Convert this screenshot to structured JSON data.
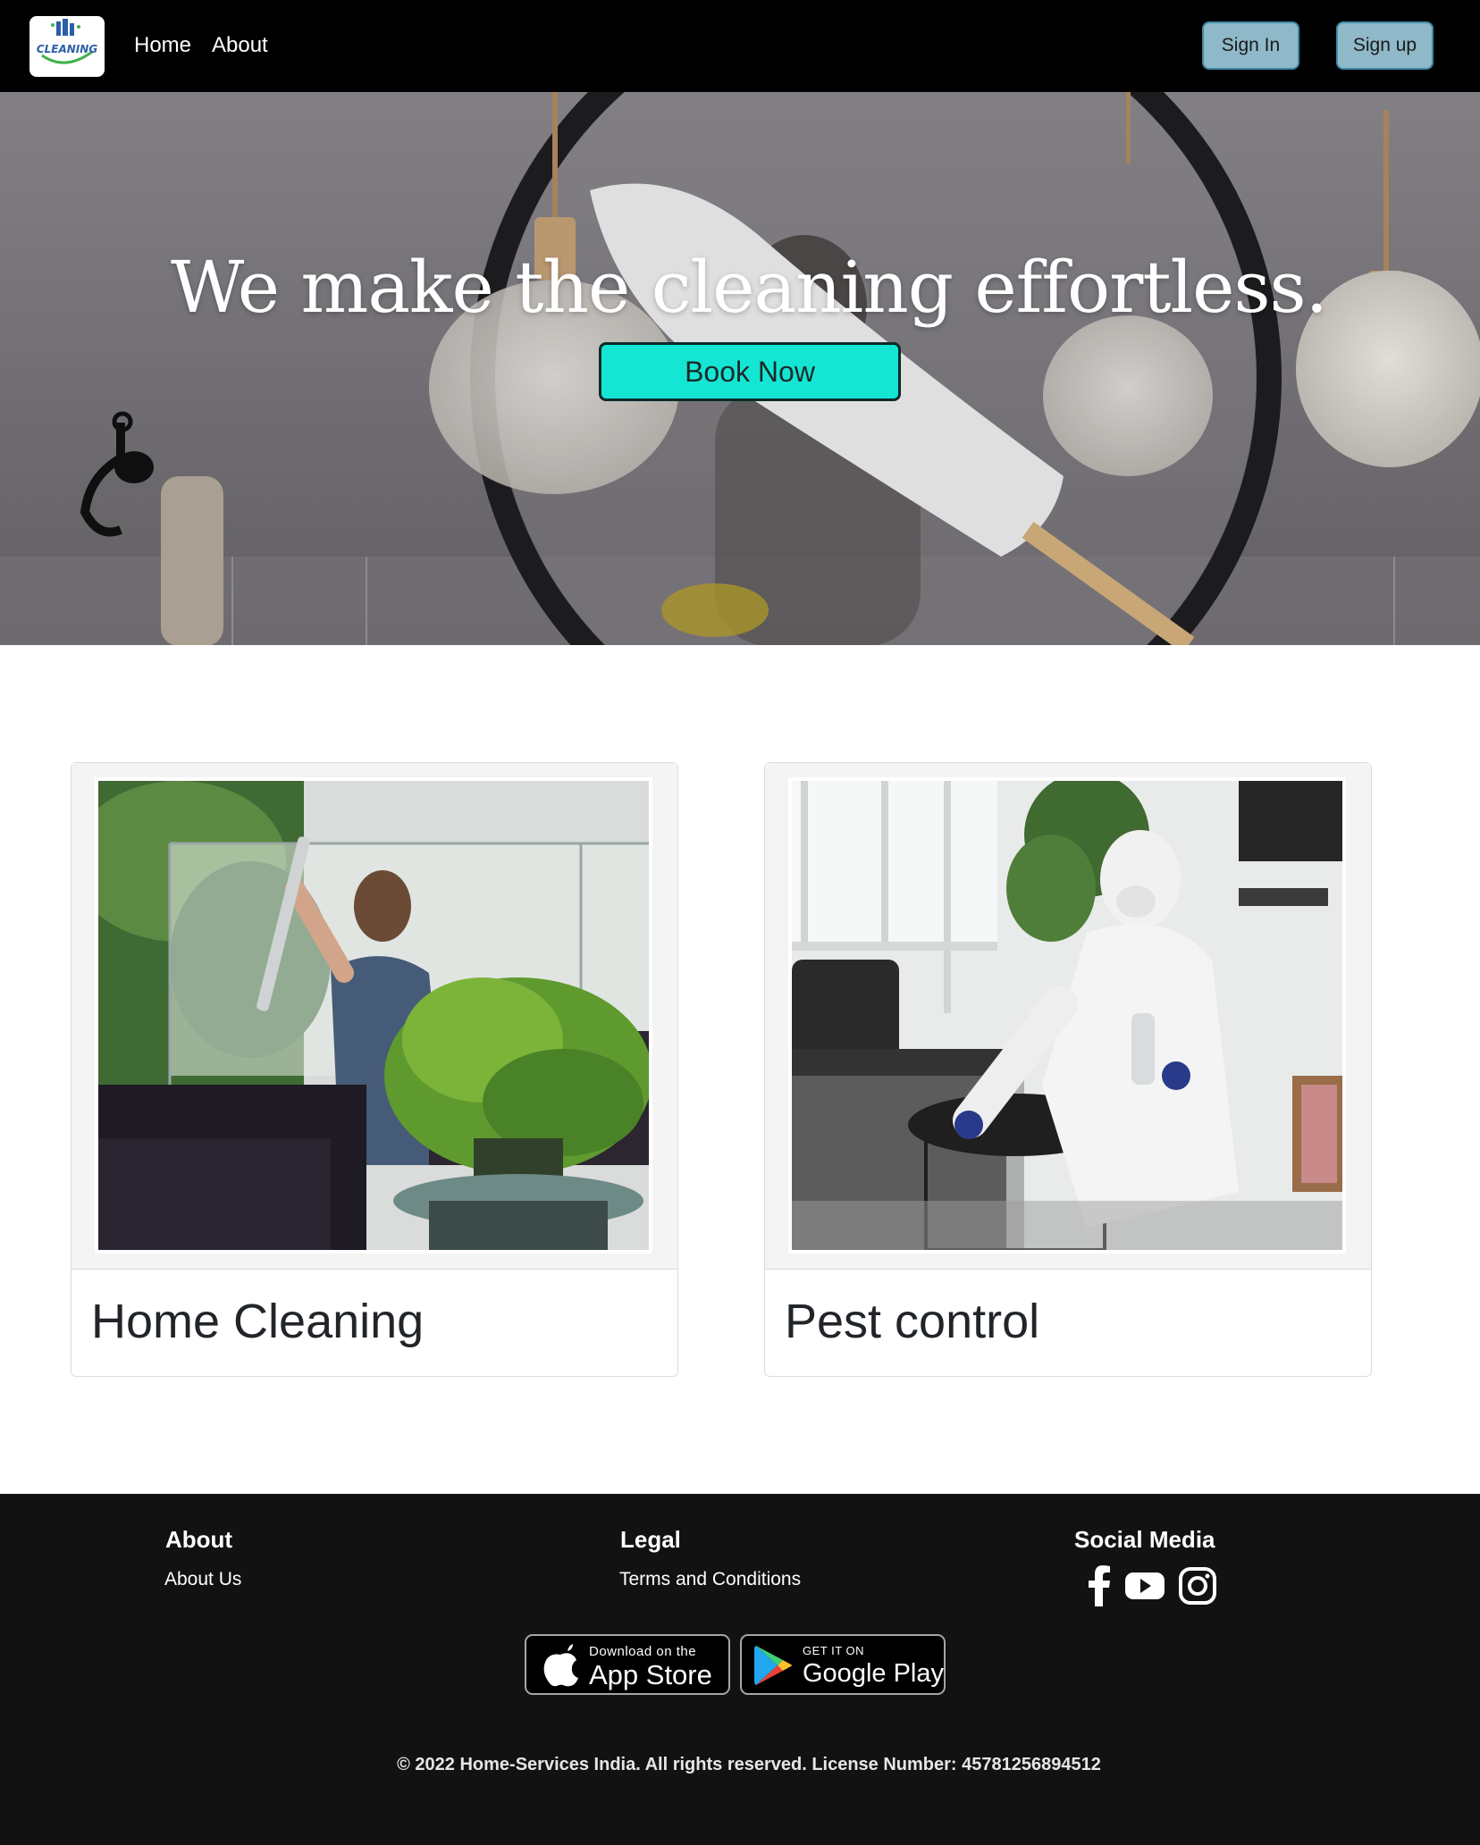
{
  "navbar": {
    "logo_text": "CLEANING",
    "links": {
      "home": "Home",
      "about": "About"
    },
    "sign_in": "Sign In",
    "sign_up": "Sign up"
  },
  "hero": {
    "title": "We make the cleaning effortless.",
    "cta": "Book Now"
  },
  "services": [
    {
      "title": "Home Cleaning",
      "image": "man cleaning glass window"
    },
    {
      "title": "Pest control",
      "image": "worker in protective suit disinfecting table"
    }
  ],
  "footer": {
    "about": {
      "heading": "About",
      "link": "About Us"
    },
    "legal": {
      "heading": "Legal",
      "link": "Terms and Conditions"
    },
    "social": {
      "heading": "Social Media",
      "icons": [
        "facebook-icon",
        "youtube-icon",
        "instagram-icon"
      ]
    },
    "app_store": {
      "small": "Download on the",
      "big": "App Store"
    },
    "google_play": {
      "small": "GET IT ON",
      "big": "Google Play"
    },
    "copyright": "© 2022 Home-Services India. All rights reserved. License Number: 45781256894512"
  },
  "colors": {
    "navbar_bg": "#000000",
    "auth_button": "#8fb9c9",
    "book_button": "#15e6d4",
    "footer_bg": "#131212"
  }
}
